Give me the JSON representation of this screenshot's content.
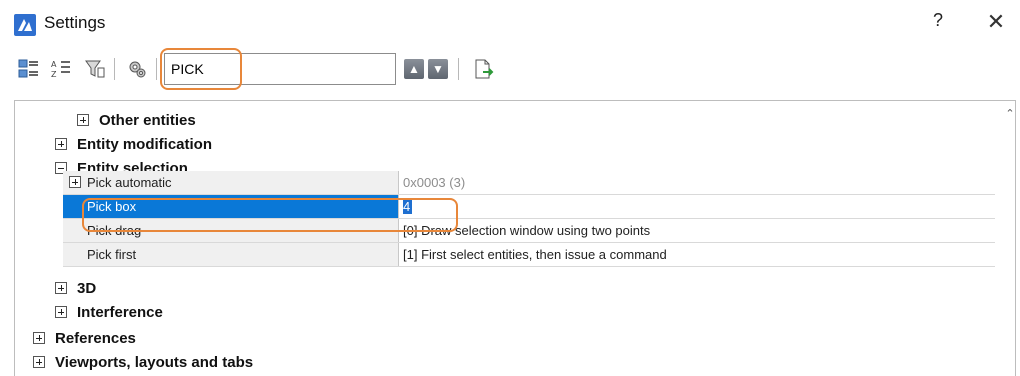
{
  "window": {
    "title": "Settings",
    "help_label": "?",
    "close_label": "✕"
  },
  "toolbar": {
    "search": {
      "value": "PICK",
      "placeholder": ""
    },
    "icons": [
      "categorized-view-icon",
      "alphabetical-view-icon",
      "filter-icon",
      "settings-icon",
      "move-up-icon",
      "move-down-icon",
      "export-icon"
    ]
  },
  "tree": {
    "groups_top": [
      {
        "label": "Other entities",
        "expanded": false
      },
      {
        "label": "Entity modification",
        "expanded": false
      },
      {
        "label": "Entity selection",
        "expanded": true
      }
    ],
    "properties": [
      {
        "name": "Pick automatic",
        "value": "0x0003 (3)",
        "expandable": true,
        "grey": true
      },
      {
        "name": "Pick box",
        "value": "4",
        "selected": true
      },
      {
        "name": "Pick drag",
        "value": "[0] Draw selection window using two points"
      },
      {
        "name": "Pick first",
        "value": "[1] First select entities, then issue a command"
      }
    ],
    "groups_bottom": [
      {
        "label": "3D",
        "expanded": false
      },
      {
        "label": "Interference",
        "expanded": false
      },
      {
        "label": "References",
        "expanded": false
      },
      {
        "label": "Viewports, layouts and tabs",
        "expanded": false
      }
    ]
  },
  "colors": {
    "accent_highlight": "#e8873a",
    "selection_blue": "#0a78d7",
    "app_icon": "#2f6fcf"
  }
}
